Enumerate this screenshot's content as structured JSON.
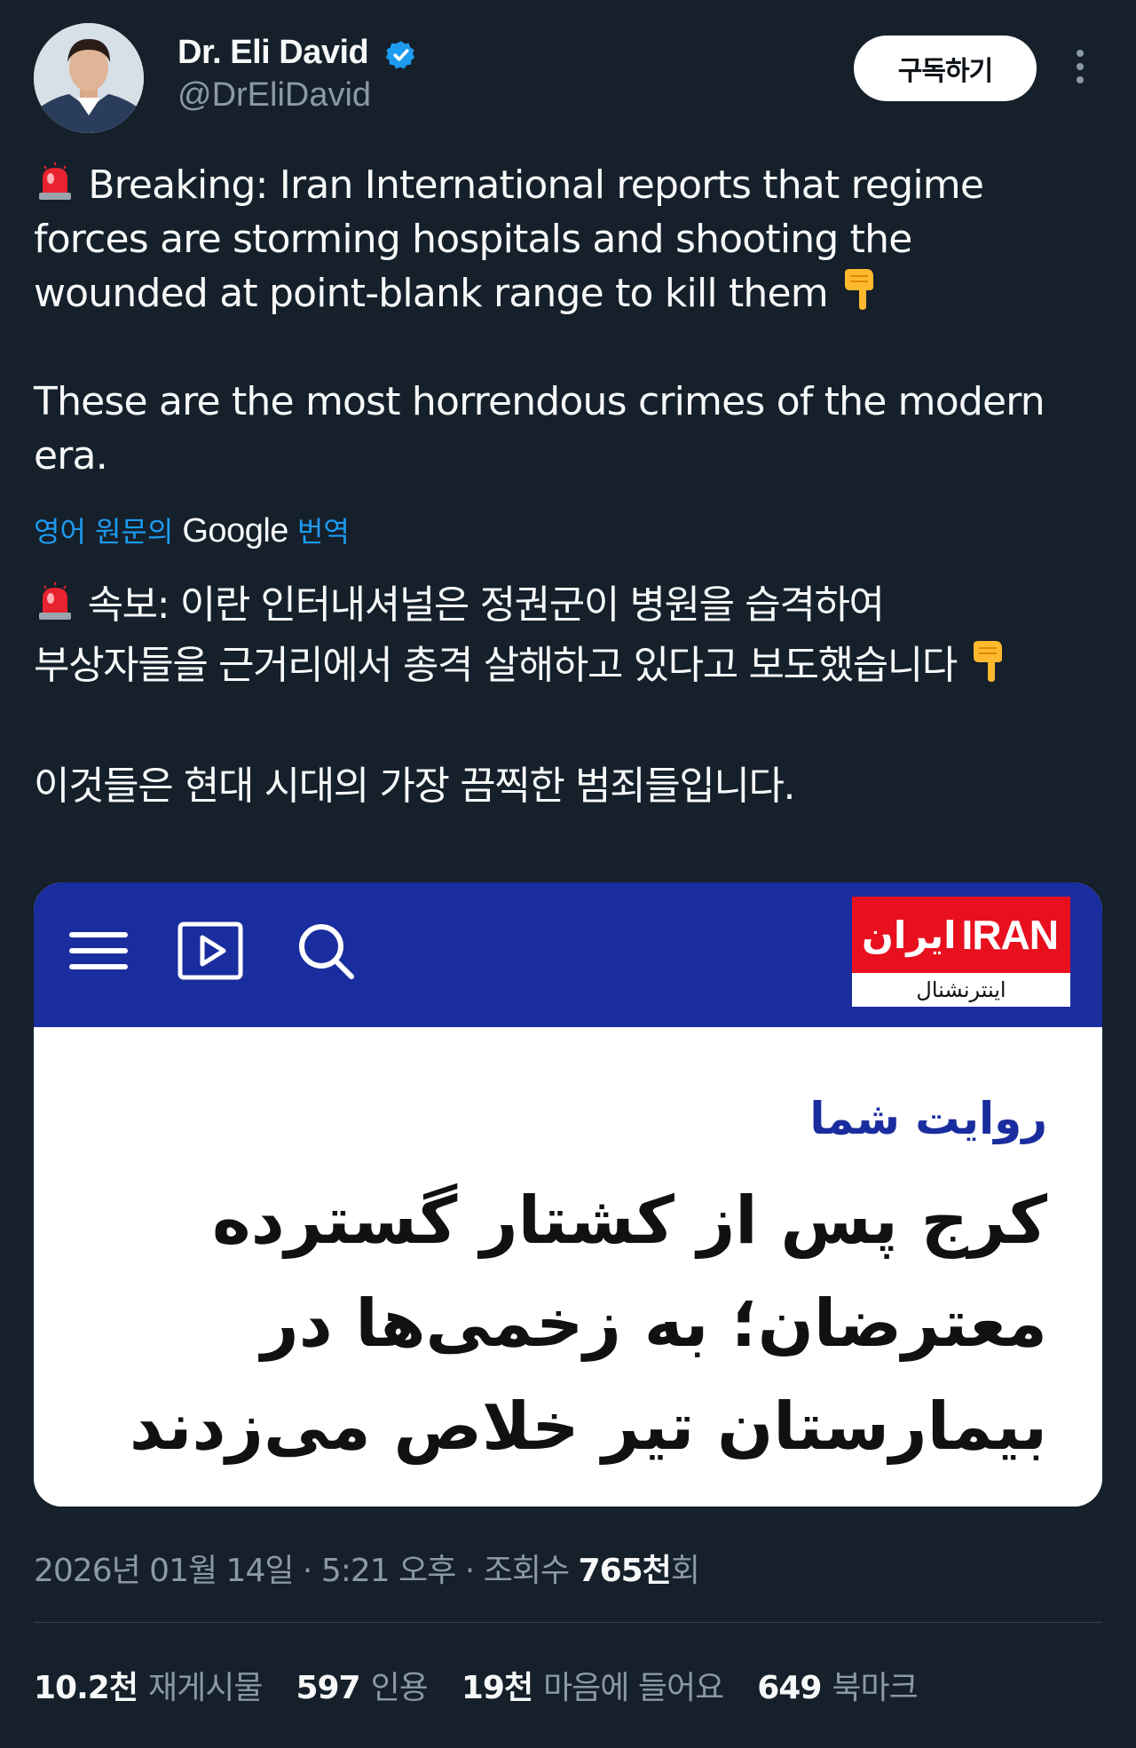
{
  "header": {
    "display_name": "Dr. Eli David",
    "handle": "@DrEliDavid",
    "subscribe_label": "구독하기"
  },
  "tweet": {
    "text_line1": "Breaking: Iran International reports that regime",
    "text_line2": "forces are storming hospitals and shooting the",
    "text_line3": "wounded at point-blank range to kill them",
    "text_para2": "These are the most horrendous crimes of the modern\nera.",
    "translate_prefix": "영어 원문의",
    "translate_brand": "Google",
    "translate_suffix": "번역",
    "translated_line1": "속보: 이란 인터내셔널은 정권군이 병원을 습격하여",
    "translated_line2": "부상자들을 근거리에서 총격 살해하고 있다고 보도했습니다",
    "translated_para2": "이것들은 현대 시대의 가장 끔찍한 범죄들입니다."
  },
  "media": {
    "logo_fa": "ایران",
    "logo_en": "IRAN",
    "logo_sub": "اینترنشنال",
    "kicker": "روایت شما",
    "headline": "کرج پس از کشتار گسترده معترضان؛ به زخمی‌ها در بیمارستان تیر خلاص می‌زدند"
  },
  "meta": {
    "date": "2026년 01월 14일",
    "time": "5:21 오후",
    "views_prefix": "조회수",
    "views_count": "765천",
    "views_suffix": "회"
  },
  "stats": [
    {
      "count": "10.2천",
      "label": "재게시물"
    },
    {
      "count": "597",
      "label": "인용"
    },
    {
      "count": "19천",
      "label": "마음에 들어요"
    },
    {
      "count": "649",
      "label": "북마크"
    }
  ],
  "colors": {
    "background": "#15202b",
    "accent": "#1d9bf0",
    "nav_blue": "#1a2d9e",
    "logo_red": "#e8101f"
  },
  "icons": [
    "avatar",
    "verified-icon",
    "more-icon",
    "siren-emoji",
    "pointing-down-emoji",
    "menu-icon",
    "video-icon",
    "search-icon"
  ]
}
